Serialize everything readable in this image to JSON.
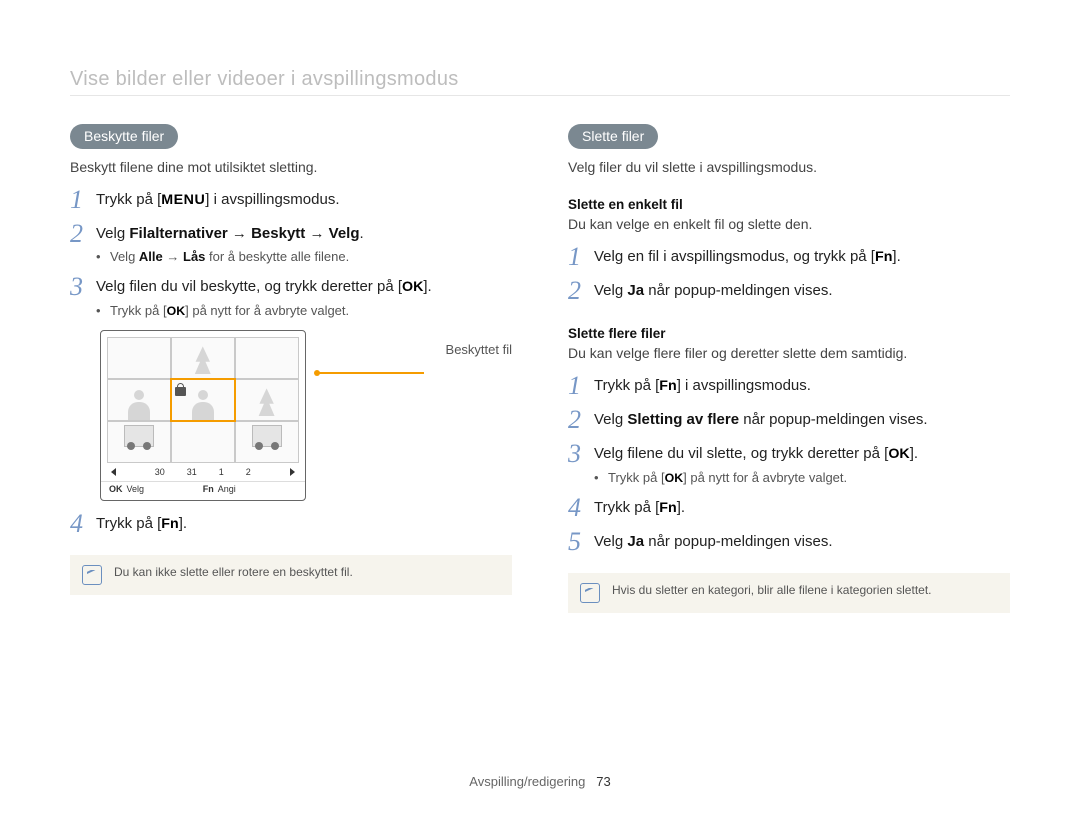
{
  "page": {
    "title": "Vise bilder eller videoer i avspillingsmodus",
    "footer_label": "Avspilling/redigering",
    "page_number": "73"
  },
  "btn": {
    "menu": "MENU",
    "ok": "OK",
    "fn": "Fn"
  },
  "left": {
    "pill": "Beskytte filer",
    "intro": "Beskytt filene dine mot utilsiktet sletting.",
    "step1_a": "Trykk på [",
    "step1_b": "] i avspillingsmodus.",
    "step2_a": "Velg ",
    "step2_b1": "Filalternativer",
    "step2_arrow1": " → ",
    "step2_b2": "Beskytt",
    "step2_arrow2": " → ",
    "step2_b3": "Velg",
    "step2_dot": ".",
    "step2_sub_a": "Velg ",
    "step2_sub_b1": "Alle",
    "step2_sub_arrow": " → ",
    "step2_sub_b2": "Lås",
    "step2_sub_c": " for å beskytte alle filene.",
    "step3_a": "Velg filen du vil beskytte, og trykk deretter på [",
    "step3_b": "].",
    "step3_sub_a": "Trykk på [",
    "step3_sub_b": "] på nytt for å avbryte valget.",
    "callout": "Beskyttet fil",
    "pager": {
      "prev": "‹",
      "d1": "30",
      "d2": "31",
      "d3": "1",
      "d4": "2",
      "next": "›"
    },
    "bottombar": {
      "ok": "OK",
      "ok_label": "Velg",
      "fn": "Fn",
      "fn_label": "Angi"
    },
    "step4_a": "Trykk på [",
    "step4_b": "].",
    "note": "Du kan ikke slette eller rotere en beskyttet fil."
  },
  "right": {
    "pill": "Slette filer",
    "intro": "Velg filer du vil slette i avspillingsmodus.",
    "sec1_title": "Slette en enkelt fil",
    "sec1_intro": "Du kan velge en enkelt fil og slette den.",
    "sec1_step1_a": "Velg en fil i avspillingsmodus, og trykk på [",
    "sec1_step1_b": "].",
    "sec1_step2_a": "Velg ",
    "sec1_step2_b": "Ja",
    "sec1_step2_c": " når popup-meldingen vises.",
    "sec2_title": "Slette flere filer",
    "sec2_intro": "Du kan velge flere filer og deretter slette dem samtidig.",
    "sec2_step1_a": "Trykk på [",
    "sec2_step1_b": "] i avspillingsmodus.",
    "sec2_step2_a": "Velg ",
    "sec2_step2_b": "Sletting av flere",
    "sec2_step2_c": " når popup-meldingen vises.",
    "sec2_step3_a": "Velg filene du vil slette, og trykk deretter på [",
    "sec2_step3_b": "].",
    "sec2_step3_sub_a": "Trykk på [",
    "sec2_step3_sub_b": "] på nytt for å avbryte valget.",
    "sec2_step4_a": "Trykk på [",
    "sec2_step4_b": "].",
    "sec2_step5_a": "Velg ",
    "sec2_step5_b": "Ja",
    "sec2_step5_c": " når popup-meldingen vises.",
    "note": "Hvis du sletter en kategori, blir alle filene i kategorien slettet."
  }
}
